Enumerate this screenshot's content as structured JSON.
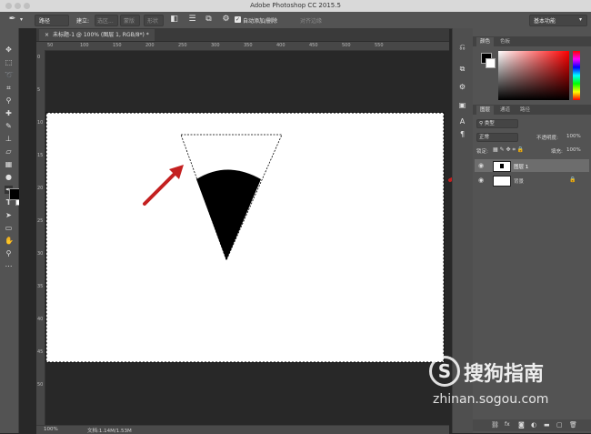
{
  "app": {
    "window_title": "Adobe Photoshop CC 2015.5"
  },
  "options_bar": {
    "tool_mode": "路径",
    "make_label": "建立:",
    "selection_btn": "选区...",
    "mask_btn": "蒙版",
    "shape_btn": "形状",
    "auto_add_delete_label": "自动添加/删除",
    "auto_add_delete_checked": true,
    "align_edges": "对齐边缘",
    "workspace": "基本功能"
  },
  "document": {
    "tab_title": "未标题-1 @ 100% (图层 1, RGB/8*) *",
    "zoom": "100%",
    "doc_info": "文档:1.14M/1.53M",
    "h_ruler_ticks": [
      "50",
      "100",
      "150",
      "200",
      "250",
      "300",
      "350",
      "400",
      "450",
      "500",
      "550"
    ],
    "v_ruler_ticks": [
      "0",
      "5",
      "10",
      "15",
      "20",
      "25",
      "30",
      "35",
      "40",
      "45",
      "50"
    ]
  },
  "panels": {
    "color_tabs": [
      "颜色",
      "色板"
    ],
    "layer_tabs": [
      "图层",
      "通道",
      "路径"
    ],
    "kind_filter": "类型",
    "blend_mode": "正常",
    "opacity_label": "不透明度:",
    "opacity": "100%",
    "lock_label": "锁定:",
    "fill_label": "填充:",
    "fill": "100%",
    "layers": [
      {
        "name": "图层 1",
        "visible": true,
        "selected": true
      },
      {
        "name": "背景",
        "visible": true,
        "selected": false,
        "locked": true
      }
    ]
  },
  "watermark": {
    "brand": "搜狗指南",
    "url": "zhinan.sogou.com"
  },
  "colors": {
    "foreground": "#000000",
    "background": "#ffffff",
    "annotation_arrow": "#c42020"
  }
}
